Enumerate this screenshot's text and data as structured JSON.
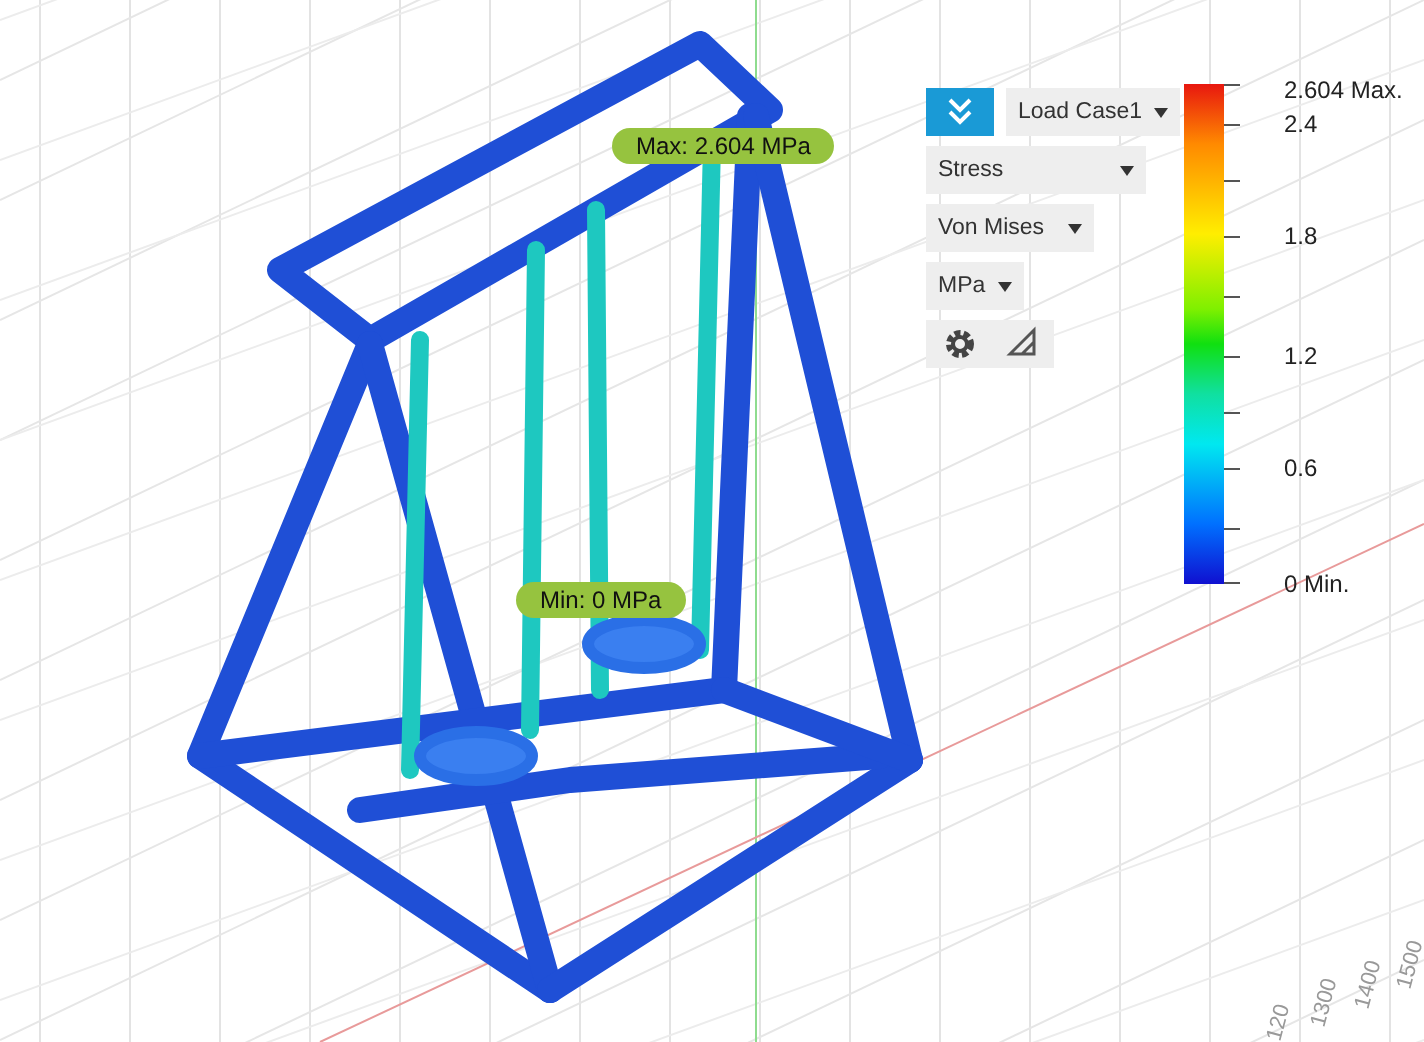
{
  "viewport": {
    "probes": [
      {
        "label": "Max: 2.604 MPa"
      },
      {
        "label": "Min: 0 MPa"
      }
    ],
    "axis_ticks": [
      "120",
      "1300",
      "1400",
      "1500"
    ]
  },
  "panel": {
    "dropdowns": [
      {
        "label": "Load Case1"
      },
      {
        "label": "Stress"
      },
      {
        "label": "Von Mises"
      },
      {
        "label": "MPa"
      }
    ]
  },
  "legend": {
    "labels": [
      "2.604 Max.",
      "2.4",
      "1.8",
      "1.2",
      "0.6",
      "0 Min."
    ]
  }
}
